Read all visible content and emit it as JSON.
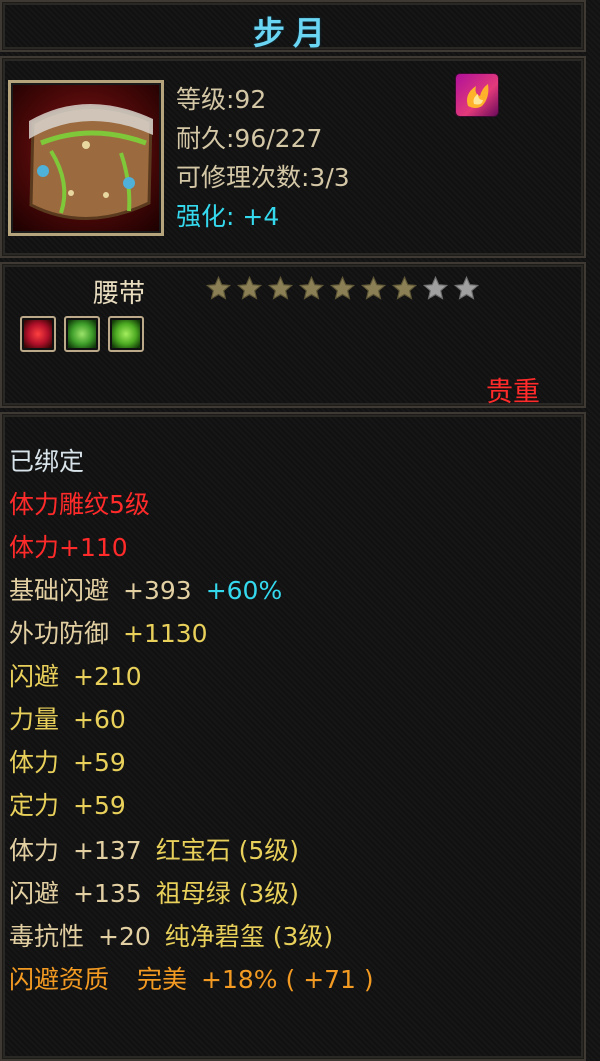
{
  "item": {
    "name": "步月",
    "level": "等级:92",
    "durability": "耐久:96/227",
    "repair_count": "可修理次数:3/3",
    "enhance": "强化: +4",
    "type": "腰带",
    "rarity": "贵重",
    "stars_filled": 7,
    "stars_total": 9
  },
  "icons": {
    "item_icon": "belt-item-icon",
    "skill_badge": "flame-skill-badge-icon",
    "gems": [
      "red-gem-socket-icon",
      "green-gem-socket-icon",
      "green-gem-socket-icon"
    ]
  },
  "stats": {
    "bound": "已绑定",
    "engraving": "体力雕纹5级",
    "engraving_bonus": "体力+110",
    "base_dodge_label": "基础闪避",
    "base_dodge_value": "+393",
    "base_dodge_pct": "+60%",
    "lines": [
      {
        "label": "外功防御",
        "value": "+1130"
      },
      {
        "label": "闪避",
        "value": "+210"
      },
      {
        "label": "力量",
        "value": "+60"
      },
      {
        "label": "体力",
        "value": "+59"
      },
      {
        "label": "定力",
        "value": "+59"
      }
    ],
    "gem_lines": [
      {
        "label": "体力",
        "value": "+137",
        "gem": "红宝石 (5级)"
      },
      {
        "label": "闪避",
        "value": "+135",
        "gem": "祖母绿 (3级)"
      },
      {
        "label": "毒抗性",
        "value": "+20",
        "gem": "纯净碧玺 (3级)"
      }
    ],
    "quality_label": "闪避资质",
    "quality_grade": "完美",
    "quality_value": "+18% ( +71 )"
  },
  "colors": {
    "title": "#6ad6f4",
    "cyan": "#35d9ee",
    "red": "#ff2a2a",
    "yellow": "#e8d05a",
    "orange": "#f29a22",
    "star_filled": "#8a7f55",
    "star_empty": "#a0a0a0"
  }
}
